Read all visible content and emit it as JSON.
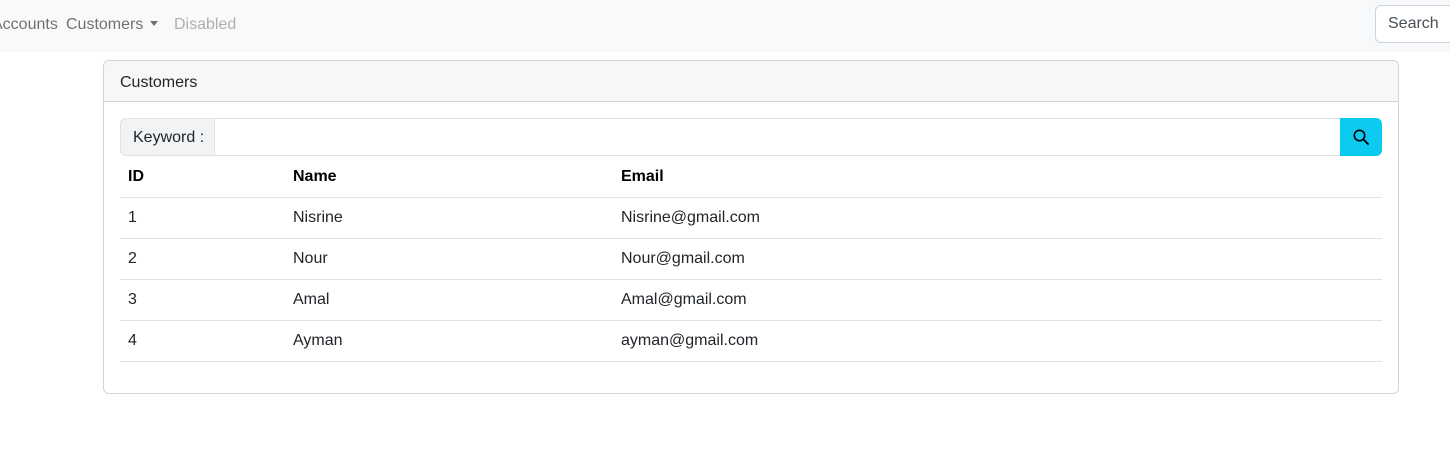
{
  "navbar": {
    "links": {
      "accounts": "Accounts",
      "customers": "Customers",
      "disabled": "Disabled"
    },
    "search_placeholder": "Search"
  },
  "card": {
    "title": "Customers",
    "search": {
      "label": "Keyword :",
      "value": "",
      "button_icon": "search-icon"
    },
    "table": {
      "headers": {
        "id": "ID",
        "name": "Name",
        "email": "Email"
      },
      "rows": [
        {
          "id": "1",
          "name": "Nisrine",
          "email": "Nisrine@gmail.com"
        },
        {
          "id": "2",
          "name": "Nour",
          "email": "Nour@gmail.com"
        },
        {
          "id": "3",
          "name": "Amal",
          "email": "Amal@gmail.com"
        },
        {
          "id": "4",
          "name": "Ayman",
          "email": "ayman@gmail.com"
        }
      ]
    }
  },
  "colors": {
    "navbar_bg": "#f8f9fa",
    "search_button": "#0dcaf0",
    "card_header_bg": "#f7f7f7"
  }
}
